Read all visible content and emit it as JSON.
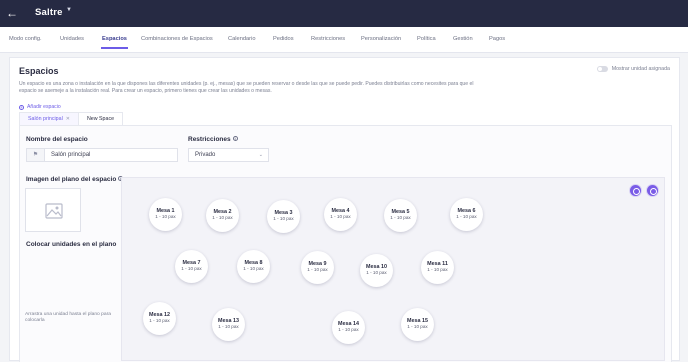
{
  "header": {
    "brand": "Saltre"
  },
  "nav": {
    "tabs": [
      {
        "label": "Modo config."
      },
      {
        "label": "Unidades"
      },
      {
        "label": "Espacios",
        "active": true
      },
      {
        "label": "Combinaciones de Espacios"
      },
      {
        "label": "Calendario"
      },
      {
        "label": "Pedidos"
      },
      {
        "label": "Restricciones"
      },
      {
        "label": "Personalización"
      },
      {
        "label": "Política"
      },
      {
        "label": "Gestión"
      },
      {
        "label": "Pagos"
      }
    ]
  },
  "page": {
    "title": "Espacios",
    "description": "Un espacio es una zona o instalación en la que dispones las diferentes unidades (p. ej., mesas) que se pueden reservar o desde las que se puede pedir. Puedes distribuirlas como necesites para que el espacio se asemeje a la instalación real. Para crear un espacio, primero tienes que crear las unidades o mesas.",
    "toggle_label": "Mostrar unidad asignada",
    "add_space_label": "Añadir espacio",
    "space_tabs": [
      {
        "label": "Salón principal",
        "active": true
      },
      {
        "label": "New Space"
      }
    ]
  },
  "form": {
    "name_label": "Nombre del espacio",
    "name_value": "Salón principal",
    "restrictions_label": "Restricciones",
    "restrictions_value": "Privado",
    "floorplan_label": "Imagen del plano del espacio",
    "place_units_label": "Colocar unidades en el plano",
    "place_units_help": "Arrastra una unidad hasta el plano para colocarla"
  },
  "tables": [
    {
      "name": "Mesa 1",
      "capacity": "1 - 10 pax"
    },
    {
      "name": "Mesa 2",
      "capacity": "1 - 10 pax"
    },
    {
      "name": "Mesa 3",
      "capacity": "1 - 10 pax"
    },
    {
      "name": "Mesa 4",
      "capacity": "1 - 10 pax"
    },
    {
      "name": "Mesa 5",
      "capacity": "1 - 10 pax"
    },
    {
      "name": "Mesa 6",
      "capacity": "1 - 10 pax"
    },
    {
      "name": "Mesa 7",
      "capacity": "1 - 10 pax"
    },
    {
      "name": "Mesa 8",
      "capacity": "1 - 10 pax"
    },
    {
      "name": "Mesa 9",
      "capacity": "1 - 10 pax"
    },
    {
      "name": "Mesa 10",
      "capacity": "1 - 10 pax"
    },
    {
      "name": "Mesa 11",
      "capacity": "1 - 10 pax"
    },
    {
      "name": "Mesa 12",
      "capacity": "1 - 10 pax"
    },
    {
      "name": "Mesa 13",
      "capacity": "1 - 10 pax"
    },
    {
      "name": "Mesa 14",
      "capacity": "1 - 10 pax"
    },
    {
      "name": "Mesa 15",
      "capacity": "1 - 10 pax"
    }
  ],
  "colors": {
    "header_bg": "#262a43",
    "accent": "#6c5ce7"
  },
  "icons": {
    "back": "arrow-left-icon",
    "caret": "caret-down-icon",
    "info": "info-icon",
    "flag": "flag-icon",
    "image": "image-icon",
    "select": "chevron-down-icon",
    "add": "plus-circle-icon",
    "close": "close-icon"
  }
}
